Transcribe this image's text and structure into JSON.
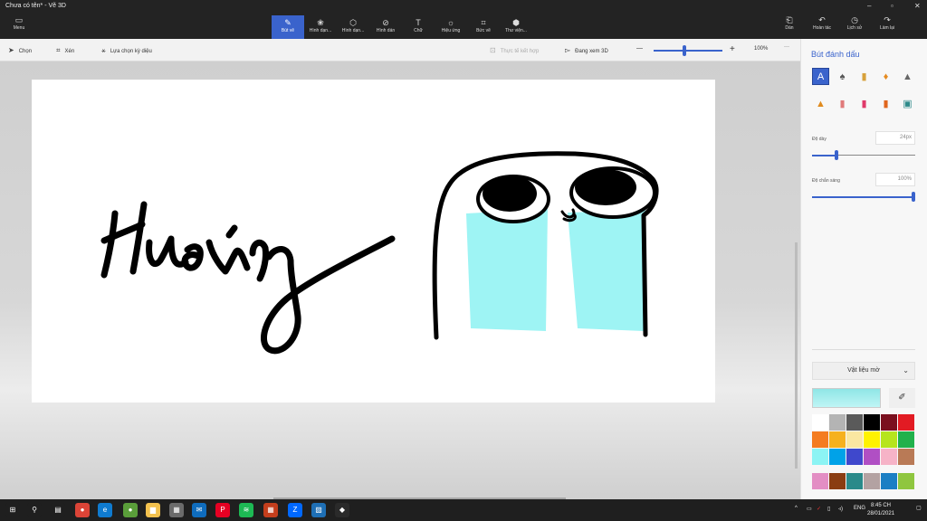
{
  "window": {
    "title": "Chưa có tên* - Vẽ 3D",
    "controls": {
      "minimize": "–",
      "maximize": "▫",
      "close": "✕"
    }
  },
  "ribbon": {
    "menu_label": "Menu",
    "tools": [
      {
        "label": "Bút vẽ",
        "icon": "brush-icon",
        "glyph": "✎",
        "active": true
      },
      {
        "label": "Hình dạn...",
        "icon": "shapes-3d-icon",
        "glyph": "❀",
        "active": false
      },
      {
        "label": "Hình dạn...",
        "icon": "cube-icon",
        "glyph": "⬡",
        "active": false
      },
      {
        "label": "Hình dán",
        "icon": "sticker-icon",
        "glyph": "⊘",
        "active": false
      },
      {
        "label": "Chữ",
        "icon": "text-icon",
        "glyph": "T",
        "active": false
      },
      {
        "label": "Hiệu ứng",
        "icon": "effects-icon",
        "glyph": "☼",
        "active": false
      },
      {
        "label": "Bức vẽ",
        "icon": "canvas-icon",
        "glyph": "⌗",
        "active": false
      },
      {
        "label": "Thư viện...",
        "icon": "library-icon",
        "glyph": "⬢",
        "active": false
      }
    ],
    "right_tools": [
      {
        "label": "Dán",
        "icon": "paste-icon",
        "glyph": "⎗"
      },
      {
        "label": "Hoàn tác",
        "icon": "undo-icon",
        "glyph": "↶"
      },
      {
        "label": "Lịch sử",
        "icon": "history-icon",
        "glyph": "◷"
      },
      {
        "label": "Làm lại",
        "icon": "redo-icon",
        "glyph": "↷"
      }
    ]
  },
  "commandbar": {
    "select": "Chọn",
    "crop": "Xén",
    "magic_select": "Lựa chọn kỳ diệu",
    "mixed_reality": "Thực tế kết hợp",
    "view_3d": "Đang xem 3D",
    "zoom_minus": "—",
    "zoom_plus": "+",
    "zoom_value": "100%",
    "more": "···",
    "zoom_level": 0.45
  },
  "panel": {
    "title": "Bút đánh dấu",
    "brushes": [
      {
        "name": "marker-brush-icon",
        "glyph": "A",
        "color": "#ffffff",
        "selected": true
      },
      {
        "name": "calligraphy-pen-icon",
        "glyph": "♠",
        "color": "#555555",
        "selected": false
      },
      {
        "name": "oil-brush-icon",
        "glyph": "▮",
        "color": "#d7a13b",
        "selected": false
      },
      {
        "name": "watercolor-icon",
        "glyph": "♦",
        "color": "#e58b20",
        "selected": false
      },
      {
        "name": "pencil-icon",
        "glyph": "▲",
        "color": "#666666",
        "selected": false
      },
      {
        "name": "crayon-icon",
        "glyph": "▲",
        "color": "#e08a1e",
        "selected": false
      },
      {
        "name": "pixel-pen-icon",
        "glyph": "▮",
        "color": "#e07a7a",
        "selected": false
      },
      {
        "name": "spray-can-icon",
        "glyph": "▮",
        "color": "#e03a6a",
        "selected": false
      },
      {
        "name": "eraser-icon",
        "glyph": "▮",
        "color": "#e0661e",
        "selected": false
      },
      {
        "name": "fill-icon",
        "glyph": "▣",
        "color": "#2e8a8a",
        "selected": false
      }
    ],
    "thickness_label": "Độ dày",
    "thickness_value": "24px",
    "thickness_level": 0.24,
    "opacity_label": "Độ chắn sáng",
    "opacity_value": "100%",
    "opacity_level": 1.0,
    "material_label": "Vật liệu mờ",
    "colors": [
      "#ffffff",
      "#b4b4b4",
      "#5a5a5a",
      "#000000",
      "#7a0f1e",
      "#e21b23",
      "#f47c20",
      "#f6b11e",
      "#fbe7a1",
      "#fff200",
      "#b6e51d",
      "#21b14b",
      "#8cf4f4",
      "#00a2e8",
      "#3f48cc",
      "#b04fc4",
      "#f6b3c7",
      "#b97a56",
      "#e38ec4",
      "#8a3d12",
      "#2a8a8a",
      "#b3a2a2",
      "#1b7fc4",
      "#8fc63f"
    ]
  },
  "taskbar": {
    "apps": [
      {
        "name": "start-icon",
        "glyph": "⊞",
        "color": "#1f1f1f"
      },
      {
        "name": "search-icon",
        "glyph": "⚲",
        "color": "#1f1f1f"
      },
      {
        "name": "task-view-icon",
        "glyph": "▤",
        "color": "#1f1f1f"
      },
      {
        "name": "chrome-icon",
        "glyph": "●",
        "color": "#db4437"
      },
      {
        "name": "edge-icon",
        "glyph": "e",
        "color": "#0f7bd0"
      },
      {
        "name": "green-app-icon",
        "glyph": "●",
        "color": "#5a9e3a"
      },
      {
        "name": "file-explorer-icon",
        "glyph": "▆",
        "color": "#f2c14e"
      },
      {
        "name": "store-icon",
        "glyph": "▦",
        "color": "#6b6b6b"
      },
      {
        "name": "mail-icon",
        "glyph": "✉",
        "color": "#0f6cbd"
      },
      {
        "name": "pinterest-icon",
        "glyph": "P",
        "color": "#e60023"
      },
      {
        "name": "spotify-icon",
        "glyph": "≋",
        "color": "#1db954"
      },
      {
        "name": "office-app-icon",
        "glyph": "▦",
        "color": "#c43e1c"
      },
      {
        "name": "zalo-icon",
        "glyph": "Z",
        "color": "#0068ff"
      },
      {
        "name": "photos-icon",
        "glyph": "▨",
        "color": "#1e6fb5"
      },
      {
        "name": "paint-3d-icon",
        "glyph": "◆",
        "color": "#2a2a2a"
      }
    ],
    "tray": {
      "chevron": "^",
      "lang": "ENG"
    },
    "time": "8:45 CH",
    "date": "28/01/2021"
  }
}
